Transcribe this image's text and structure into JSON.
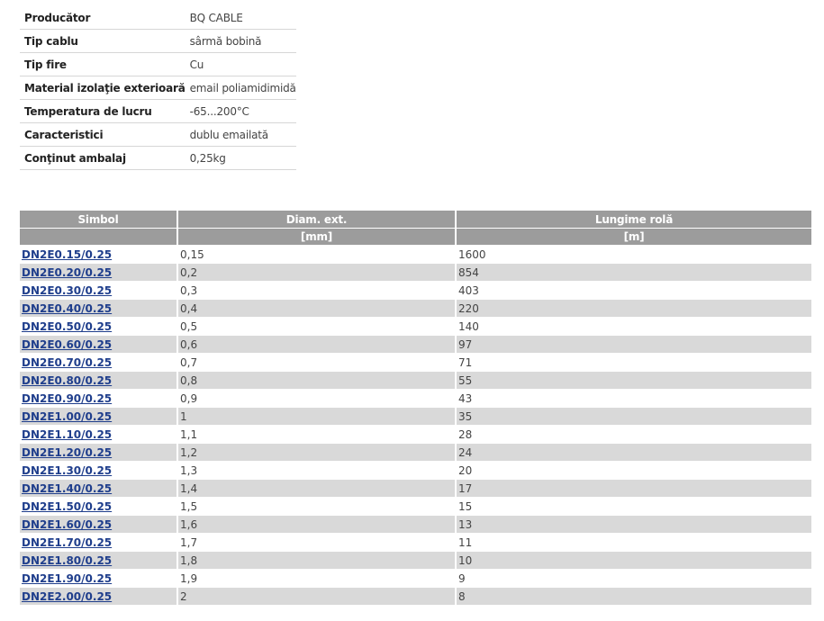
{
  "specs": [
    {
      "label": "Producător",
      "value": "BQ CABLE"
    },
    {
      "label": "Tip cablu",
      "value": "sârmă bobină"
    },
    {
      "label": "Tip fire",
      "value": "Cu"
    },
    {
      "label": "Material izolaţie exterioară",
      "value": "email poliamidimidă"
    },
    {
      "label": "Temperatura de lucru",
      "value": "-65...200°C"
    },
    {
      "label": "Caracteristici",
      "value": "dublu emailată"
    },
    {
      "label": "Conţinut ambalaj",
      "value": "0,25kg"
    }
  ],
  "products": {
    "headers": {
      "symbol": "Simbol",
      "diameter": "Diam. ext.",
      "diameter_unit": "[mm]",
      "length": "Lungime rolă",
      "length_unit": "[m]"
    },
    "rows": [
      {
        "symbol": "DN2E0.15/0.25",
        "diameter": "0,15",
        "length": "1600"
      },
      {
        "symbol": "DN2E0.20/0.25",
        "diameter": "0,2",
        "length": "854"
      },
      {
        "symbol": "DN2E0.30/0.25",
        "diameter": "0,3",
        "length": "403"
      },
      {
        "symbol": "DN2E0.40/0.25",
        "diameter": "0,4",
        "length": "220"
      },
      {
        "symbol": "DN2E0.50/0.25",
        "diameter": "0,5",
        "length": "140"
      },
      {
        "symbol": "DN2E0.60/0.25",
        "diameter": "0,6",
        "length": "97"
      },
      {
        "symbol": "DN2E0.70/0.25",
        "diameter": "0,7",
        "length": "71"
      },
      {
        "symbol": "DN2E0.80/0.25",
        "diameter": "0,8",
        "length": "55"
      },
      {
        "symbol": "DN2E0.90/0.25",
        "diameter": "0,9",
        "length": "43"
      },
      {
        "symbol": "DN2E1.00/0.25",
        "diameter": "1",
        "length": "35"
      },
      {
        "symbol": "DN2E1.10/0.25",
        "diameter": "1,1",
        "length": "28"
      },
      {
        "symbol": "DN2E1.20/0.25",
        "diameter": "1,2",
        "length": "24"
      },
      {
        "symbol": "DN2E1.30/0.25",
        "diameter": "1,3",
        "length": "20"
      },
      {
        "symbol": "DN2E1.40/0.25",
        "diameter": "1,4",
        "length": "17"
      },
      {
        "symbol": "DN2E1.50/0.25",
        "diameter": "1,5",
        "length": "15"
      },
      {
        "symbol": "DN2E1.60/0.25",
        "diameter": "1,6",
        "length": "13"
      },
      {
        "symbol": "DN2E1.70/0.25",
        "diameter": "1,7",
        "length": "11"
      },
      {
        "symbol": "DN2E1.80/0.25",
        "diameter": "1,8",
        "length": "10"
      },
      {
        "symbol": "DN2E1.90/0.25",
        "diameter": "1,9",
        "length": "9"
      },
      {
        "symbol": "DN2E2.00/0.25",
        "diameter": "2",
        "length": "8"
      }
    ]
  },
  "colors": {
    "header_bg": "#9c9c9c",
    "row_alt_bg": "#d9d9d9",
    "link": "#1f3e8c"
  }
}
